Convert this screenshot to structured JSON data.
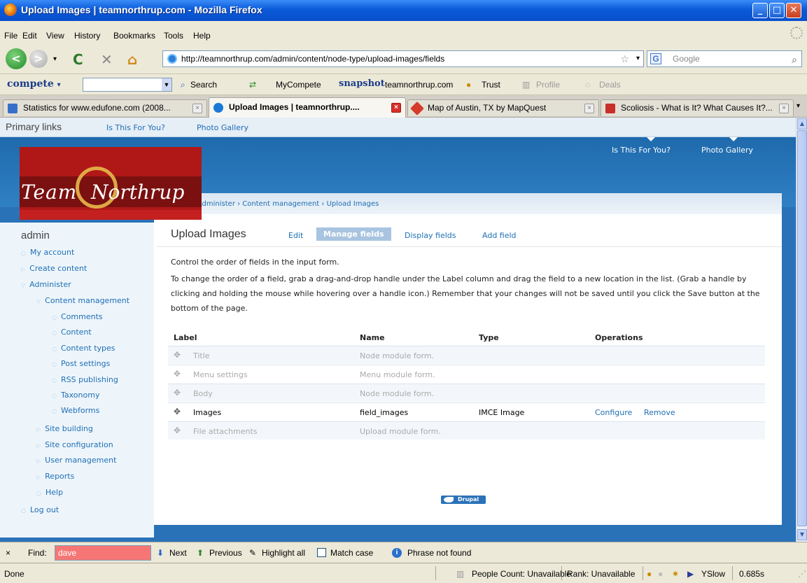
{
  "window": {
    "title": "Upload Images | teamnorthrup.com - Mozilla Firefox"
  },
  "menu": [
    "File",
    "Edit",
    "View",
    "History",
    "Bookmarks",
    "Tools",
    "Help"
  ],
  "nav": {
    "url": "http://teamnorthrup.com/admin/content/node-type/upload-images/fields",
    "search_placeholder": "Google"
  },
  "compete": {
    "brand": "compete",
    "dropdown_arrow": "▾",
    "items": [
      "Search",
      "MyCompete",
      "teamnorthrup.com",
      "Trust",
      "Profile",
      "Deals"
    ],
    "snapshot": "snapshot"
  },
  "tabs": [
    {
      "label": "Statistics for www.edufone.com (2008...",
      "icon_color": "#3a6fc9"
    },
    {
      "label": "Upload Images | teamnorthrup....",
      "icon_color": "#1b7ad8"
    },
    {
      "label": "Map of Austin, TX by MapQuest",
      "icon_color": "#d43b2a"
    },
    {
      "label": "Scoliosis - What is It? What Causes It?...",
      "icon_color": "#c8302a"
    }
  ],
  "site": {
    "primary_label": "Primary links",
    "primary_links": [
      "Is This For You?",
      "Photo Gallery"
    ],
    "logo_text_1": "Team",
    "logo_text_2": "Northrup",
    "breadcrumb": "Home › Administer › Content management › Upload Images"
  },
  "sidebar": {
    "username": "admin",
    "items": [
      {
        "label": "My account"
      },
      {
        "label": "Create content"
      },
      {
        "label": "Administer"
      },
      {
        "label": "Content management"
      },
      {
        "label": "Comments"
      },
      {
        "label": "Content"
      },
      {
        "label": "Content types"
      },
      {
        "label": "Post settings"
      },
      {
        "label": "RSS publishing"
      },
      {
        "label": "Taxonomy"
      },
      {
        "label": "Webforms"
      },
      {
        "label": "Site building"
      },
      {
        "label": "Site configuration"
      },
      {
        "label": "User management"
      },
      {
        "label": "Reports"
      },
      {
        "label": "Help"
      },
      {
        "label": "Log out"
      }
    ]
  },
  "main": {
    "title": "Upload Images",
    "tabs": [
      "Edit",
      "Manage fields",
      "Display fields",
      "Add field"
    ],
    "intro": "Control the order of fields in the input form.",
    "help": "To change the order of a field, grab a drag-and-drop handle under the Label column and drag the field to a new location in the list. (Grab a handle by clicking and holding the mouse while hovering over a handle icon.) Remember that your changes will not be saved until you click the Save button at the bottom of the page.",
    "table": {
      "headers": [
        "Label",
        "Name",
        "Type",
        "Operations"
      ],
      "rows": [
        {
          "label": "Title",
          "name": "Node module form.",
          "type": "",
          "ops": []
        },
        {
          "label": "Menu settings",
          "name": "Menu module form.",
          "type": "",
          "ops": []
        },
        {
          "label": "Body",
          "name": "Node module form.",
          "type": "",
          "ops": []
        },
        {
          "label": "Images",
          "name": "field_images",
          "type": "IMCE Image",
          "ops": [
            "Configure",
            "Remove"
          ]
        },
        {
          "label": "File attachments",
          "name": "Upload module form.",
          "type": "",
          "ops": []
        }
      ]
    },
    "footer_badge": "Drupal"
  },
  "findbar": {
    "close": "×",
    "label": "Find:",
    "value": "dave",
    "next": "Next",
    "previous": "Previous",
    "highlight": "Highlight all",
    "match_case": "Match case",
    "message": "Phrase not found"
  },
  "status": {
    "text": "Done",
    "people": "People Count: Unavailable",
    "rank": "Rank: Unavailable",
    "yslow": "YSlow",
    "time": "0.685s"
  }
}
